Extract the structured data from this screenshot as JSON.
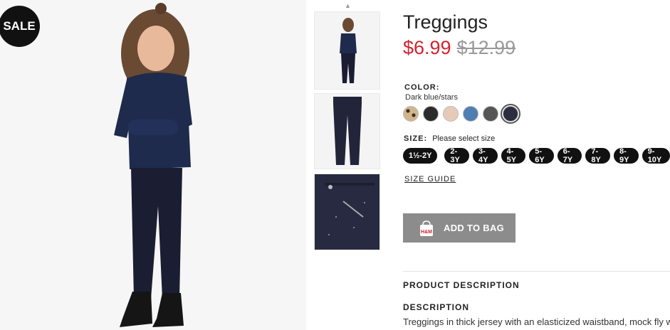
{
  "badge": {
    "sale": "SALE"
  },
  "product": {
    "title": "Treggings",
    "price_sale": "$6.99",
    "price_original": "$12.99"
  },
  "color": {
    "label": "COLOR:",
    "selected": "Dark blue/stars",
    "swatches": [
      "#b89b6b",
      "#2b2b2b",
      "#e8c9b8",
      "#4f7eb3",
      "#555555",
      "#2c2d3e"
    ]
  },
  "size": {
    "label": "SIZE:",
    "prompt": "Please select size",
    "options": [
      "1½-2Y",
      "2-3Y",
      "3-4Y",
      "4-5Y",
      "5-6Y",
      "6-7Y",
      "7-8Y",
      "8-9Y",
      "9-10Y"
    ]
  },
  "links": {
    "size_guide": "SIZE GUIDE"
  },
  "actions": {
    "add_to_bag": "ADD TO BAG",
    "bag_logo": "H&M"
  },
  "description": {
    "section_heading": "PRODUCT DESCRIPTION",
    "heading": "DESCRIPTION",
    "text": "Treggings in thick jersey with an elasticized waistband, mock fly w"
  }
}
